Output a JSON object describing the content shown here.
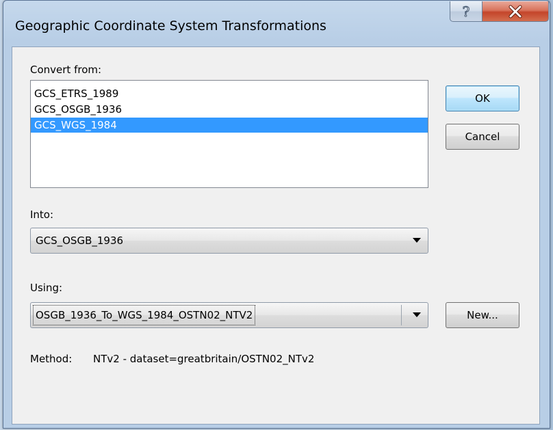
{
  "window": {
    "title": "Geographic Coordinate System Transformations",
    "help_button_label": "?",
    "close_button_label": "X"
  },
  "convert_from": {
    "label": "Convert from:",
    "items": [
      {
        "label": "GCS_ETRS_1989",
        "selected": false
      },
      {
        "label": "GCS_OSGB_1936",
        "selected": false
      },
      {
        "label": "GCS_WGS_1984",
        "selected": true
      }
    ]
  },
  "into": {
    "label": "Into:",
    "value": "GCS_OSGB_1936"
  },
  "using": {
    "label": "Using:",
    "value": "OSGB_1936_To_WGS_1984_OSTN02_NTV2"
  },
  "method": {
    "label": "Method:",
    "value": "NTv2 - dataset=greatbritain/OSTN02_NTv2"
  },
  "buttons": {
    "ok": "OK",
    "cancel": "Cancel",
    "new": "New..."
  },
  "colors": {
    "selection": "#3399ff",
    "close_button": "#c4452a",
    "dialog_face": "#f0f0f0"
  }
}
